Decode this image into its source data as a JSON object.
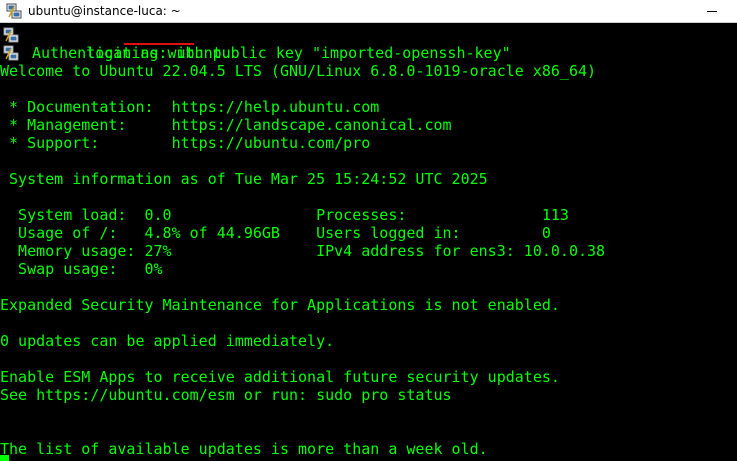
{
  "window": {
    "title": "ubuntu@instance-luca: ~"
  },
  "terminal": {
    "login_prompt": "login as: ",
    "login_user": "ubuntu",
    "auth_line": "Authenticating with public key \"imported-openssh-key\"",
    "lines": [
      "Welcome to Ubuntu 22.04.5 LTS (GNU/Linux 6.8.0-1019-oracle x86_64)",
      "",
      " * Documentation:  https://help.ubuntu.com",
      " * Management:     https://landscape.canonical.com",
      " * Support:        https://ubuntu.com/pro",
      "",
      " System information as of Tue Mar 25 15:24:52 UTC 2025",
      "",
      "  System load:  0.0                Processes:               113",
      "  Usage of /:   4.8% of 44.96GB    Users logged in:         0",
      "  Memory usage: 27%                IPv4 address for ens3: 10.0.0.38",
      "  Swap usage:   0%",
      "",
      "Expanded Security Maintenance for Applications is not enabled.",
      "",
      "0 updates can be applied immediately.",
      "",
      "Enable ESM Apps to receive additional future security updates.",
      "See https://ubuntu.com/esm or run: sudo pro status",
      "",
      "",
      "The list of available updates is more than a week old."
    ]
  },
  "colors": {
    "terminal_bg": "#000000",
    "terminal_fg": "#00ff00",
    "highlight_underline": "#e01010"
  },
  "icons": [
    "putty-icon",
    "minimize-icon"
  ]
}
